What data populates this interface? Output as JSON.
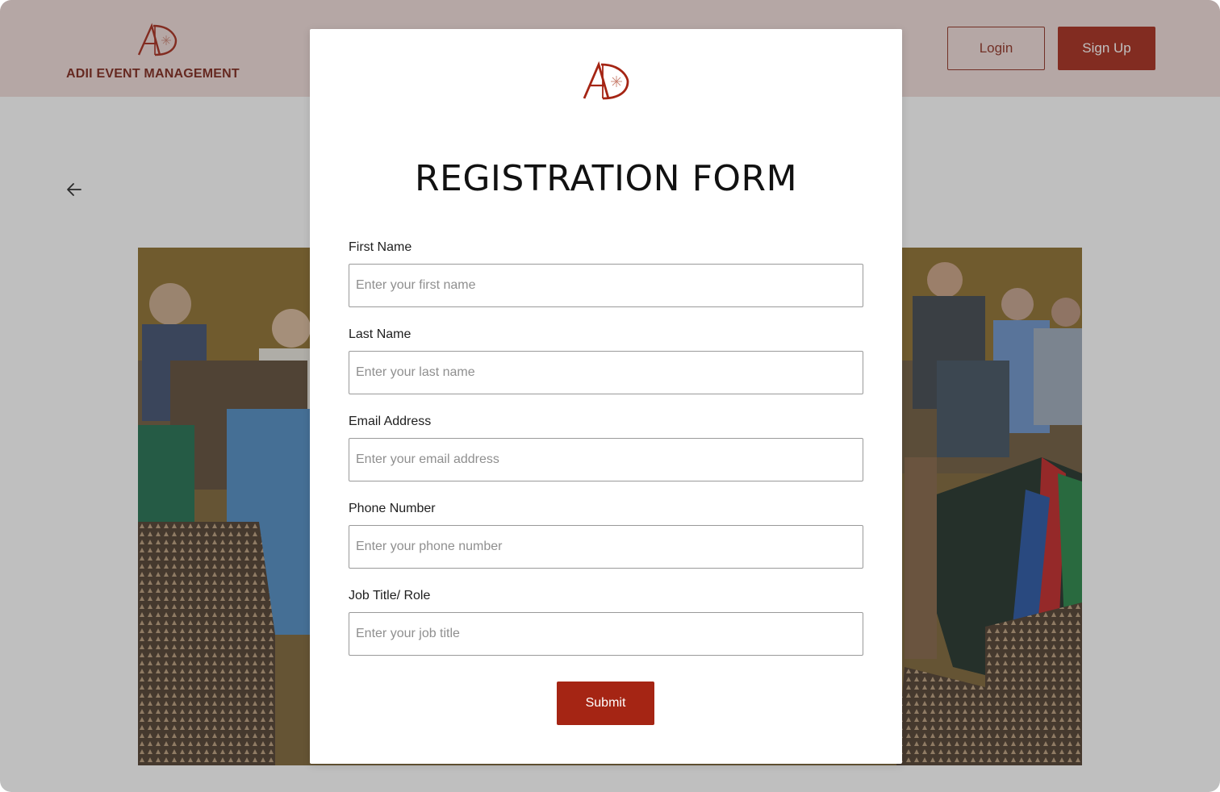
{
  "header": {
    "brand_name": "ADII EVENT MANAGEMENT",
    "brand_logo": "AD",
    "login_label": "Login",
    "signup_label": "Sign Up"
  },
  "nav": {
    "back_icon": "arrow-left-icon"
  },
  "modal": {
    "logo": "AD",
    "title": "REGISTRATION FORM",
    "fields": [
      {
        "label": "First Name",
        "placeholder": "Enter your first name"
      },
      {
        "label": "Last Name",
        "placeholder": "Enter your last name"
      },
      {
        "label": "Email Address",
        "placeholder": "Enter your email address"
      },
      {
        "label": "Phone Number",
        "placeholder": "Enter your phone number"
      },
      {
        "label": "Job Title/ Role",
        "placeholder": "Enter your job title"
      }
    ],
    "submit_label": "Submit"
  },
  "colors": {
    "header_bg": "#f1dcd9",
    "brand": "#a52514",
    "brand_text": "#7a1e12"
  }
}
